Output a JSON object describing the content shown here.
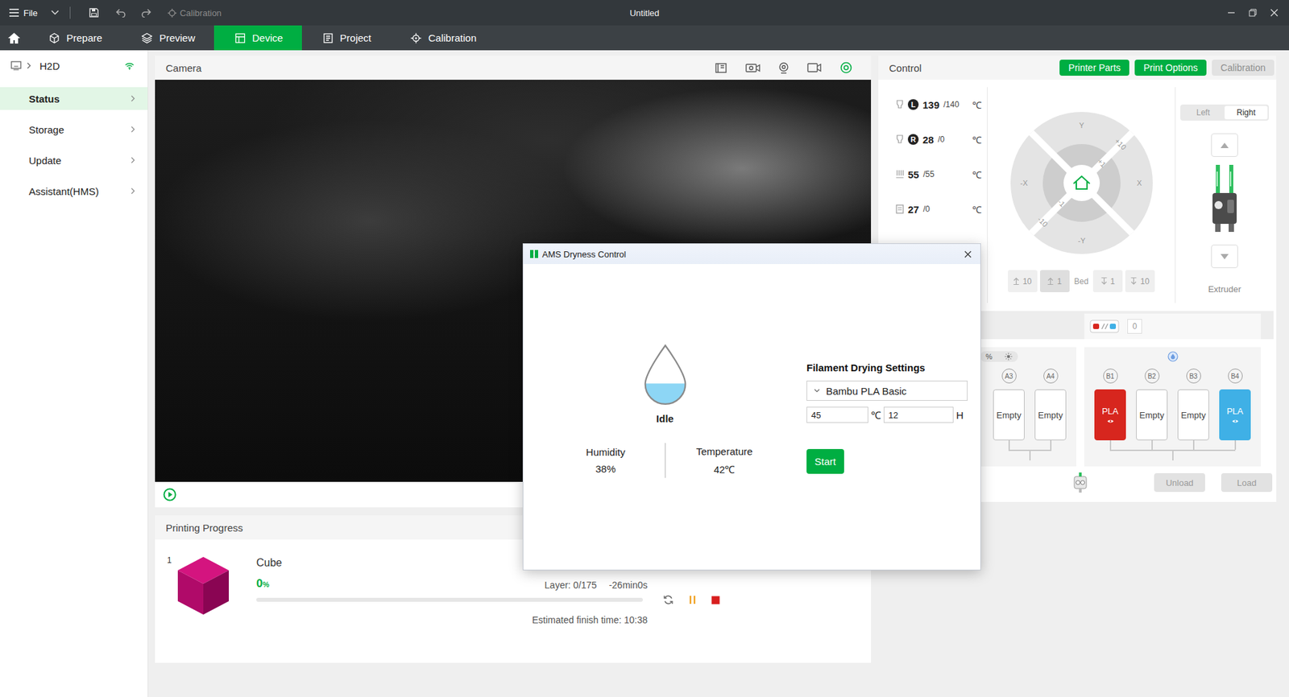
{
  "window": {
    "title": "Untitled"
  },
  "toolbar": {
    "menu": "File",
    "calibration": {
      "label": "Calibration",
      "disabled": true
    }
  },
  "tabs": [
    {
      "label": "Prepare",
      "selected": false
    },
    {
      "label": "Preview",
      "selected": false
    },
    {
      "label": "Device",
      "selected": true
    },
    {
      "label": "Project",
      "selected": false
    },
    {
      "label": "Calibration",
      "selected": false
    }
  ],
  "printer": {
    "name": "H2D",
    "connected": true
  },
  "sidebar": {
    "items": [
      {
        "label": "Status",
        "selected": true
      },
      {
        "label": "Storage",
        "selected": false
      },
      {
        "label": "Update",
        "selected": false
      },
      {
        "label": "Assistant(HMS)",
        "selected": false
      }
    ]
  },
  "camera": {
    "title": "Camera",
    "tools": [
      {
        "active": false
      },
      {
        "active": false
      },
      {
        "active": false
      },
      {
        "active": false
      },
      {
        "active": true
      }
    ],
    "playing": false
  },
  "progress": {
    "title": "Printing Progress",
    "index": "1",
    "job": "Cube",
    "percent": "0",
    "percent_unit": "%",
    "level": 0,
    "layer": "Layer: 0/175",
    "remaining": "-26min0s",
    "finish": "Estimated finish time: 10:38"
  },
  "control": {
    "title": "Control",
    "buttons": [
      {
        "label": "Printer Parts",
        "disabled": false
      },
      {
        "label": "Print Options",
        "disabled": false
      },
      {
        "label": "Calibration",
        "disabled": true
      }
    ],
    "temperatures": [
      {
        "kind": "nozzle",
        "badge": "L",
        "current": "139",
        "target": "/140",
        "unit": "℃"
      },
      {
        "kind": "nozzle",
        "badge": "R",
        "current": "28",
        "target": "/0",
        "unit": "℃"
      },
      {
        "kind": "bed",
        "current": "55",
        "target": "/55",
        "unit": "℃"
      },
      {
        "kind": "chamber",
        "current": "27",
        "target": "/0",
        "unit": "℃"
      }
    ],
    "jog": {
      "y": "Y",
      "minus_y": "-Y",
      "x": "X",
      "minus_x": "-X",
      "plus10": "+10",
      "plus1": "+1",
      "minus1": "-1",
      "minus10": "-10"
    },
    "bed": {
      "label": "Bed",
      "disabled": true,
      "up": [
        {
          "label": "10",
          "pressed": false
        },
        {
          "label": "1",
          "pressed": true
        }
      ],
      "down": [
        {
          "label": "1",
          "pressed": false
        },
        {
          "label": "10",
          "pressed": false
        }
      ]
    },
    "extruder": {
      "label": "Extruder",
      "sides": [
        {
          "label": "Left",
          "selected": false
        },
        {
          "label": "Right",
          "selected": true
        }
      ]
    }
  },
  "ams": {
    "count": "0",
    "units": [
      {
        "indicator": "humidity",
        "humidity": "%",
        "slots": [
          {
            "id": "A3",
            "kind": "empty",
            "label": "Empty"
          },
          {
            "id": "A4",
            "kind": "empty",
            "label": "Empty"
          }
        ]
      },
      {
        "indicator": "dryer",
        "slots": [
          {
            "id": "B1",
            "kind": "filament",
            "label": "PLA",
            "color": "#d7261e"
          },
          {
            "id": "B2",
            "kind": "empty",
            "label": "Empty"
          },
          {
            "id": "B3",
            "kind": "empty",
            "label": "Empty"
          },
          {
            "id": "B4",
            "kind": "filament",
            "label": "PLA",
            "color": "#3fb0e6"
          }
        ]
      }
    ],
    "buttons": [
      {
        "label": "Unload",
        "disabled": true
      },
      {
        "label": "Load",
        "disabled": true
      }
    ]
  },
  "dialog": {
    "title": "AMS Dryness Control",
    "status": "Idle",
    "level": 0.35,
    "stats": [
      {
        "label": "Humidity",
        "value": "38%"
      },
      {
        "label": "Temperature",
        "value": "42℃"
      }
    ],
    "settings": {
      "title": "Filament Drying Settings",
      "filament": "Bambu PLA Basic",
      "temperature": "45",
      "temperature_unit": "℃",
      "hours": "12",
      "hours_unit": "H",
      "action": "Start"
    }
  }
}
